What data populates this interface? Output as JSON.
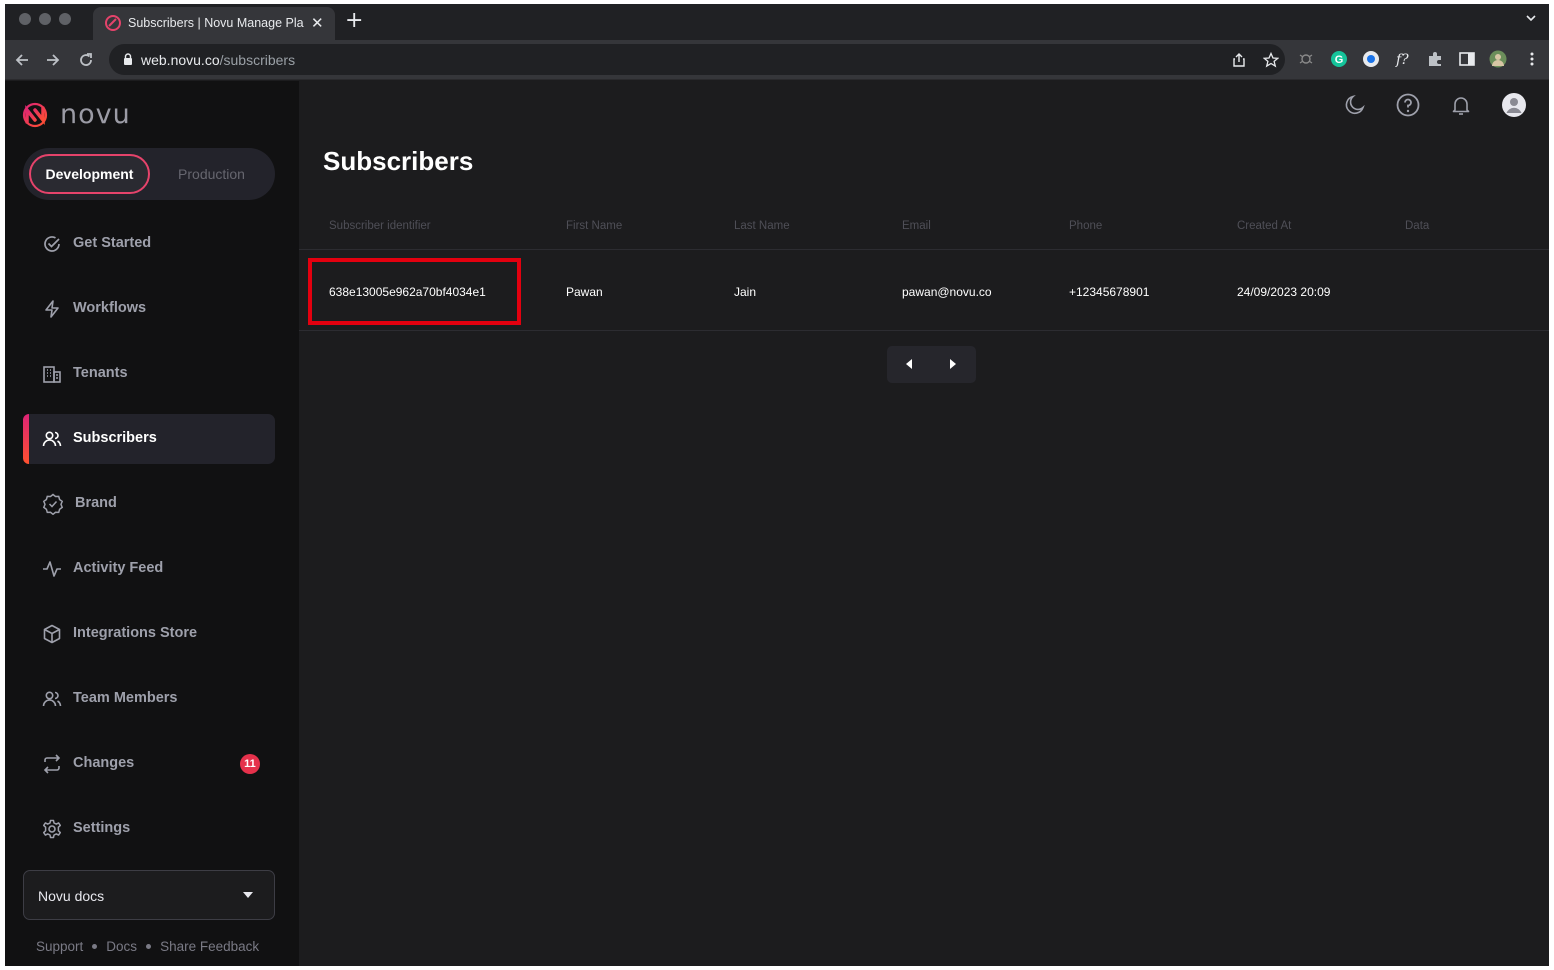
{
  "browser": {
    "tab_title": "Subscribers | Novu Manage Pla",
    "url_host": "web.novu.co",
    "url_path": "/subscribers"
  },
  "app": {
    "logo_text": "novu",
    "env": {
      "development": "Development",
      "production": "Production",
      "selected": "Development"
    },
    "nav": [
      {
        "label": "Get Started",
        "icon": "check-circle-icon"
      },
      {
        "label": "Workflows",
        "icon": "bolt-icon"
      },
      {
        "label": "Tenants",
        "icon": "building-icon"
      },
      {
        "label": "Subscribers",
        "icon": "users-icon",
        "active": true
      },
      {
        "label": "Brand",
        "icon": "brand-badge-icon"
      },
      {
        "label": "Activity Feed",
        "icon": "activity-icon"
      },
      {
        "label": "Integrations Store",
        "icon": "box-icon"
      },
      {
        "label": "Team Members",
        "icon": "team-icon"
      },
      {
        "label": "Changes",
        "icon": "swap-icon",
        "badge": "11"
      },
      {
        "label": "Settings",
        "icon": "gear-icon"
      }
    ],
    "org_select": {
      "value": "Novu docs"
    },
    "footer": {
      "support": "Support",
      "docs": "Docs",
      "feedback": "Share Feedback"
    }
  },
  "main": {
    "title": "Subscribers",
    "columns": [
      "Subscriber identifier",
      "First Name",
      "Last Name",
      "Email",
      "Phone",
      "Created At",
      "Data"
    ],
    "rows": [
      {
        "subscriber_id": "638e13005e962a70bf4034e1",
        "first_name": "Pawan",
        "last_name": "Jain",
        "email": "pawan@novu.co",
        "phone": "+12345678901",
        "created_at": "24/09/2023 20:09",
        "data": ""
      }
    ]
  },
  "colors": {
    "accent": "#e5436b",
    "badge": "#e5314b",
    "highlight": "#e3000f"
  }
}
